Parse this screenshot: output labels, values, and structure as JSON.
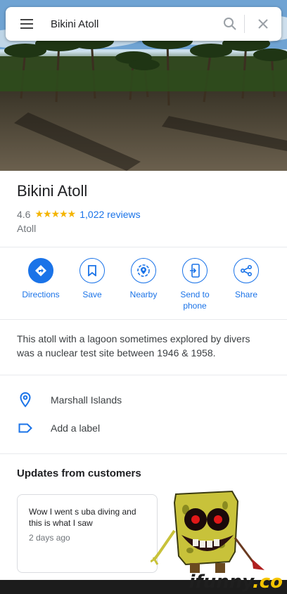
{
  "search": {
    "query": "Bikini Atoll"
  },
  "place": {
    "name": "Bikini Atoll",
    "rating": "4.6",
    "stars": "★★★★★",
    "reviews": "1,022 reviews",
    "category": "Atoll"
  },
  "actions": [
    {
      "label": "Directions",
      "icon": "directions-icon"
    },
    {
      "label": "Save",
      "icon": "bookmark-icon"
    },
    {
      "label": "Nearby",
      "icon": "nearby-icon"
    },
    {
      "label": "Send to phone",
      "icon": "send-to-phone-icon"
    },
    {
      "label": "Share",
      "icon": "share-icon"
    }
  ],
  "description": "This atoll with a lagoon sometimes explored by divers was a nuclear test site between 1946 & 1958.",
  "info": {
    "location": "Marshall Islands",
    "label": "Add a label"
  },
  "updates": {
    "title": "Updates from customers",
    "post": {
      "text": "Wow I went s uba diving and this is what I saw",
      "time": "2 days ago"
    }
  },
  "watermark": {
    "main": "ifunny",
    "suffix": ".co"
  },
  "colors": {
    "accent": "#1a73e8",
    "star": "#f4b400",
    "text": "#202124",
    "muted": "#70757a"
  }
}
